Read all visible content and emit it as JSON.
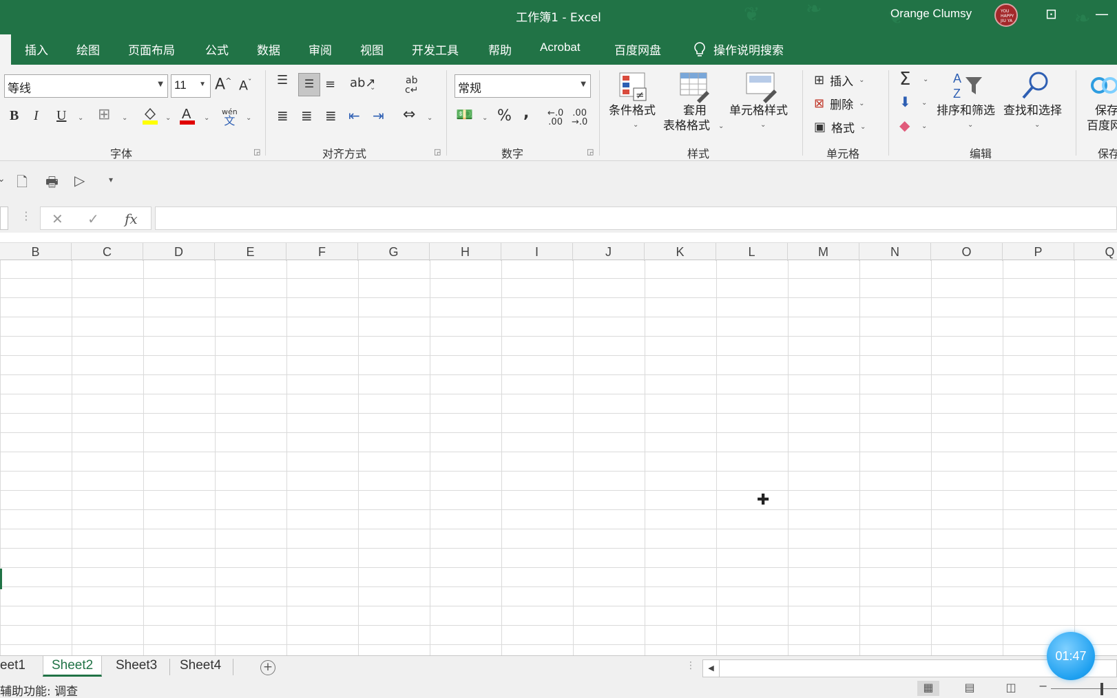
{
  "window": {
    "title": "工作簿1  -  Excel",
    "user": "Orange Clumsy",
    "avatar_text": "YOU HAPPY JIU YA",
    "restore_icon": "ribbon-display-icon",
    "minimize_icon": "minimize-icon"
  },
  "tabs": [
    "插入",
    "绘图",
    "页面布局",
    "公式",
    "数据",
    "审阅",
    "视图",
    "开发工具",
    "帮助",
    "Acrobat",
    "百度网盘"
  ],
  "tell_me": "操作说明搜索",
  "ribbon": {
    "font": {
      "name": "等线",
      "size": "11",
      "bold": "B",
      "italic": "I",
      "underline": "U",
      "label": "字体",
      "phonetic_top": "wén",
      "phonetic_bottom": "文"
    },
    "alignment": {
      "label": "对齐方式",
      "wrap": "ab"
    },
    "number": {
      "format": "常规",
      "percent": "%",
      "comma": ",",
      "inc_decimal": ".00",
      "dec_decimal": ".00",
      "label": "数字"
    },
    "styles": {
      "conditional": "条件格式",
      "table_line1": "套用",
      "table_line2": "表格格式",
      "cell_styles": "单元格样式",
      "label": "样式"
    },
    "cells": {
      "insert": "插入",
      "delete": "删除",
      "format": "格式",
      "label": "单元格"
    },
    "editing": {
      "sort_filter": "排序和筛选",
      "find_select": "查找和选择",
      "label": "编辑",
      "sum": "Σ"
    },
    "save": {
      "line1": "保存",
      "line2": "百度网",
      "label": "保存"
    }
  },
  "formula_bar": {
    "cancel": "✕",
    "enter": "✓",
    "fx": "fx",
    "value": ""
  },
  "columns": [
    "B",
    "C",
    "D",
    "E",
    "F",
    "G",
    "H",
    "I",
    "J",
    "K",
    "L",
    "M",
    "N",
    "O",
    "P",
    "Q"
  ],
  "sheets": [
    {
      "name": "eet1",
      "active": false
    },
    {
      "name": "Sheet2",
      "active": true
    },
    {
      "name": "Sheet3",
      "active": false
    },
    {
      "name": "Sheet4",
      "active": false
    }
  ],
  "status": {
    "accessibility": "辅助功能: 调查"
  },
  "timer": "01:47",
  "colors": {
    "excel_green": "#217346",
    "timer_blue": "#1ea0f0"
  }
}
